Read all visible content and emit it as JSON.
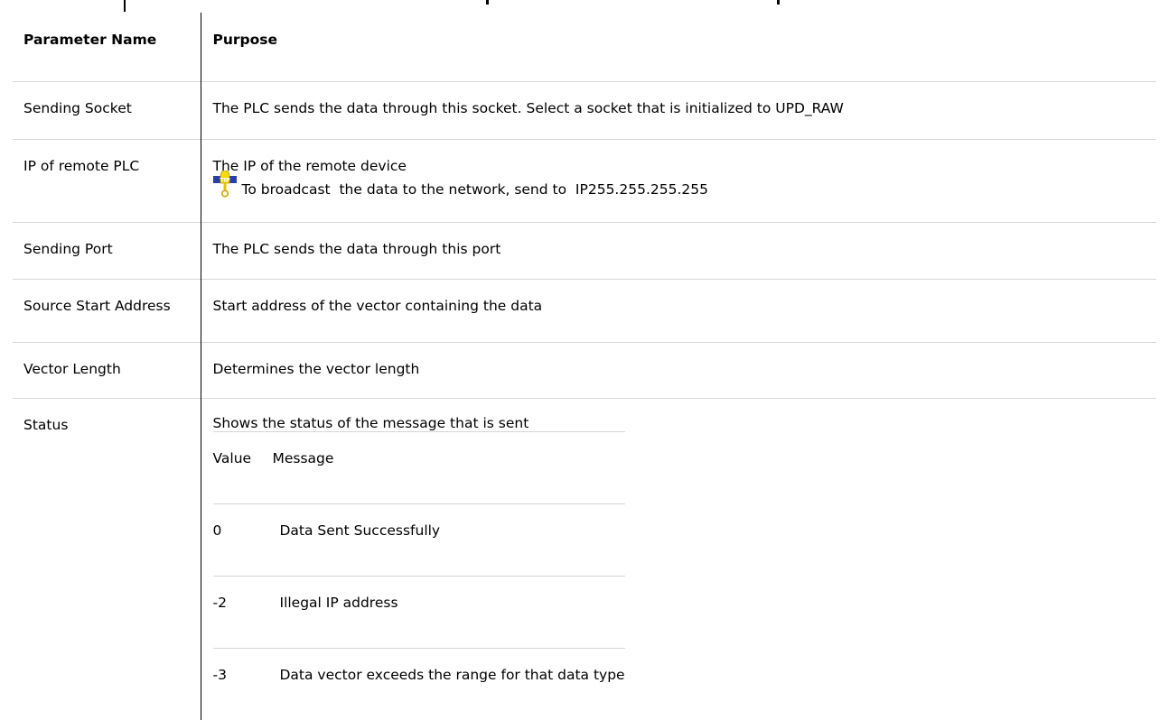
{
  "table": {
    "header": {
      "name": "Parameter Name",
      "purpose": "Purpose"
    },
    "rows": [
      {
        "name": "Sending Socket",
        "purpose": "The PLC sends the data through this socket. Select a socket that is initialized to UPD_RAW"
      },
      {
        "name": "IP of remote PLC",
        "purpose": "The IP of the remote device",
        "tip_text": "To broadcast  the data to the network, send to  IP255.255.255.255"
      },
      {
        "name": "Sending Port",
        "purpose": "The PLC sends the data through this port"
      },
      {
        "name": "Source Start Address",
        "purpose": "Start address of the vector containing the data"
      },
      {
        "name": "Vector Length",
        "purpose": "Determines the vector length"
      },
      {
        "name": "Status",
        "purpose": "Shows the status of the message that is sent",
        "status_table": {
          "header": [
            "Value",
            "Message"
          ],
          "rows": [
            {
              "value": "0",
              "message": "Data Sent Successfully"
            },
            {
              "value": "-2",
              "message": "Illegal IP address"
            },
            {
              "value": "-3",
              "message": "Data vector exceeds the range for that data type"
            }
          ]
        }
      }
    ]
  },
  "icons": {
    "tip": "tip-icon"
  },
  "colors": {
    "tip_banner": "#2a3fa8",
    "tip_bulb": "#f5d90a",
    "row_divider": "#d7d7d7"
  }
}
